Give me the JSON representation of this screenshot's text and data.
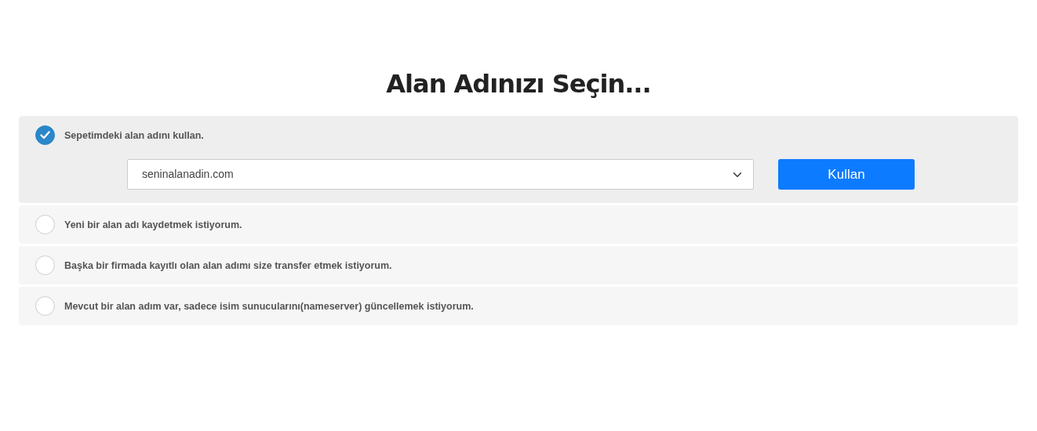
{
  "title": "Alan Adınızı Seçin...",
  "options": [
    {
      "label": "Sepetimdeki alan adını kullan.",
      "selected": true,
      "domain_select": {
        "value": "seninalanadin.com"
      },
      "button": "Kullan"
    },
    {
      "label": "Yeni bir alan adı kaydetmek istiyorum.",
      "selected": false
    },
    {
      "label": "Başka bir firmada kayıtlı olan alan adımı size transfer etmek istiyorum.",
      "selected": false
    },
    {
      "label": "Mevcut bir alan adım var, sadece isim sunucularını(nameserver) güncellemek istiyorum.",
      "selected": false
    }
  ]
}
